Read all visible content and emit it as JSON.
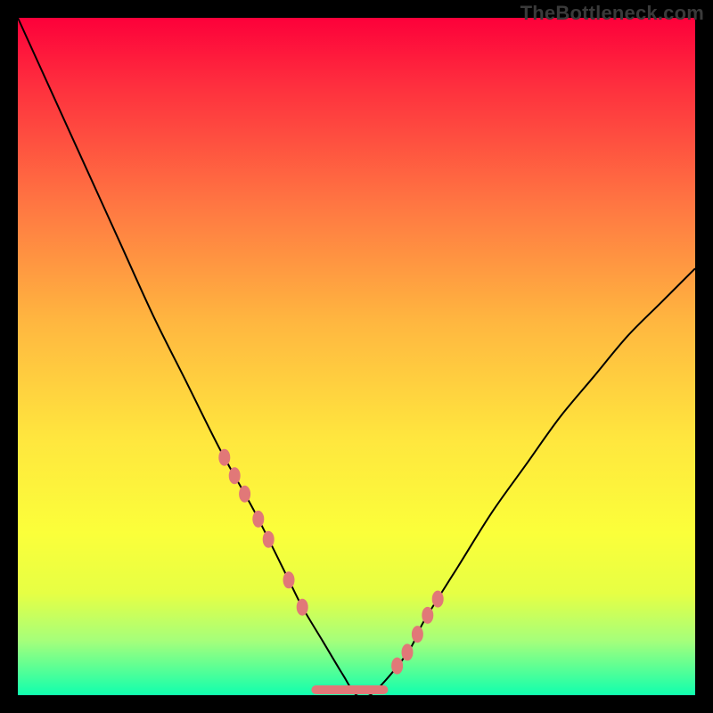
{
  "watermark": "TheBottleneck.com",
  "colors": {
    "background": "#000000",
    "gradient_top": "#fd003a",
    "gradient_bottom": "#10ffae",
    "curve": "#000000",
    "marker": "#e17878"
  },
  "chart_data": {
    "type": "line",
    "title": "",
    "xlabel": "",
    "ylabel": "",
    "xlim": [
      0,
      100
    ],
    "ylim": [
      0,
      100
    ],
    "x": [
      0,
      5,
      10,
      15,
      20,
      25,
      30,
      35,
      40,
      42,
      45,
      48,
      50,
      52,
      55,
      58,
      60,
      65,
      70,
      75,
      80,
      85,
      90,
      95,
      100
    ],
    "y": [
      100,
      89,
      78,
      67,
      56,
      46,
      36,
      27,
      17,
      13,
      8,
      3,
      0,
      0,
      3,
      7,
      11,
      19,
      27,
      34,
      41,
      47,
      53,
      58,
      63
    ],
    "floor_markers_x": [
      30.5,
      32,
      33.5,
      35.5,
      37,
      40,
      42,
      56,
      57.5,
      59,
      60.5,
      62
    ],
    "floor_band_x": [
      44,
      54
    ]
  }
}
